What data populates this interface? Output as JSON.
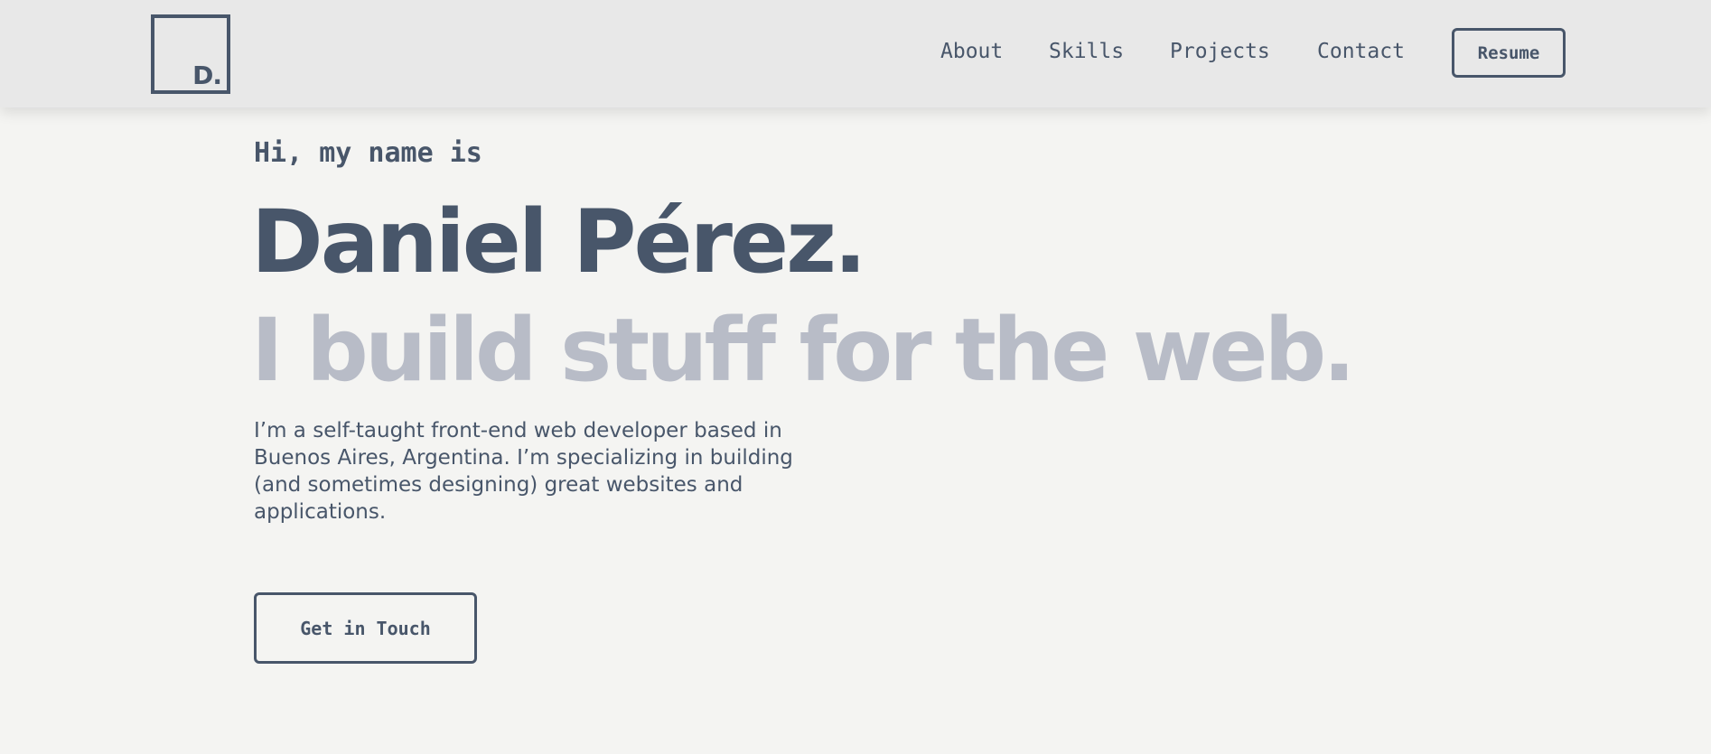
{
  "header": {
    "logo_text": "D.",
    "nav": [
      {
        "label": "About"
      },
      {
        "label": "Skills"
      },
      {
        "label": "Projects"
      },
      {
        "label": "Contact"
      }
    ],
    "resume_label": "Resume"
  },
  "hero": {
    "greeting": "Hi, my name is",
    "name": "Daniel Pérez.",
    "tagline": "I build stuff for the web.",
    "intro": "I’m a self-taught front-end web developer based in Buenos Aires, Argentina. I’m specializing in building (and sometimes designing) great websites and applications.",
    "cta_label": "Get in Touch"
  },
  "colors": {
    "background": "#f4f4f2",
    "header_background": "#e8e8e8",
    "primary_text": "#48566a",
    "muted_text": "#b8bcc7"
  }
}
